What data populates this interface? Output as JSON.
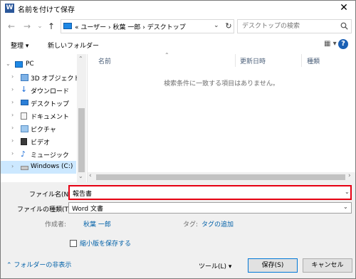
{
  "window": {
    "title": "名前を付けて保存",
    "app_icon": "W",
    "close": "✕"
  },
  "nav": {
    "back": "←",
    "forward": "→",
    "recent": "⌄",
    "up": "↑"
  },
  "address": {
    "text": "« ユーザー › 秋葉 一郎 › デスクトップ",
    "chevron": "⌄",
    "refresh": "↻"
  },
  "search": {
    "placeholder": "デスクトップの検索"
  },
  "toolbar": {
    "organize": "整理 ▾",
    "new_folder": "新しいフォルダー",
    "view": "▦ ▾",
    "help": "?"
  },
  "sidebar": {
    "items": [
      {
        "label": "PC",
        "arrow": "⌄"
      },
      {
        "label": "3D オブジェクト",
        "arrow": "›"
      },
      {
        "label": "ダウンロード",
        "arrow": "›"
      },
      {
        "label": "デスクトップ",
        "arrow": "›"
      },
      {
        "label": "ドキュメント",
        "arrow": "›"
      },
      {
        "label": "ピクチャ",
        "arrow": "›"
      },
      {
        "label": "ビデオ",
        "arrow": "›"
      },
      {
        "label": "ミュージック",
        "arrow": "›"
      },
      {
        "label": "Windows (C:)",
        "arrow": "›"
      }
    ],
    "scroll_up": "⌃",
    "scroll_down": "⌄"
  },
  "file_list": {
    "columns": [
      "名前",
      "更新日時",
      "種類"
    ],
    "sort_indicator": "⌃",
    "empty_message": "検索条件に一致する項目はありません。",
    "scroll_left": "‹",
    "scroll_right": "›"
  },
  "form": {
    "filename_label": "ファイル名(N):",
    "filename_value": "報告書",
    "filetype_label": "ファイルの種類(T):",
    "filetype_value": "Word 文書",
    "chevron": "⌄",
    "author_label": "作成者:",
    "author_value": "秋葉 一郎",
    "tags_label": "タグ:",
    "tags_value": "タグの追加",
    "thumbnail_label": "縮小版を保存する",
    "hide_folders": "⌃ フォルダーの非表示",
    "tools": "ツール(L) ▾",
    "save": "保存(S)",
    "cancel": "キャンセル"
  },
  "colors": {
    "highlight_border": "#e60012",
    "selected_bg": "#cce8ff",
    "link": "#0060a8"
  }
}
